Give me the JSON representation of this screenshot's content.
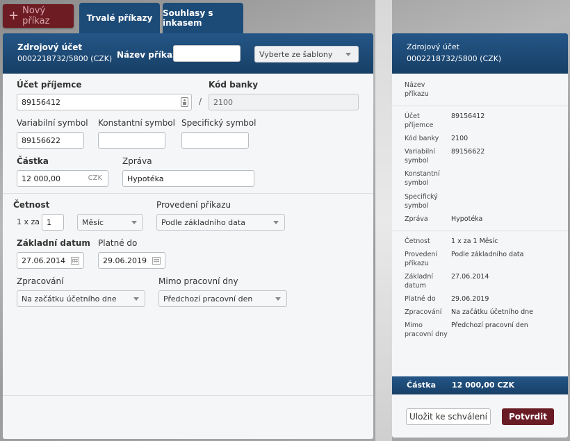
{
  "top": {
    "new_order": "Nový příkaz",
    "tabs": [
      "Trvalé příkazy",
      "Souhlasy s inkasem"
    ]
  },
  "form": {
    "source_label": "Zdrojový účet",
    "source_account": "0002218732/5800 (CZK)",
    "name_label": "Název příkazu",
    "name_value": "",
    "template_select": "Vyberte ze šablony",
    "recipient_label": "Účet příjemce",
    "recipient_value": "89156412",
    "bank_label": "Kód banky",
    "bank_value": "2100",
    "slash": "/",
    "vs_label": "Variabilní symbol",
    "vs_value": "89156622",
    "ks_label": "Konstantní symbol",
    "ks_value": "",
    "ss_label": "Specifický symbol",
    "ss_value": "",
    "amount_label": "Částka",
    "amount_value": "12 000,00",
    "currency": "CZK",
    "message_label": "Zpráva",
    "message_value": "Hypotéka",
    "frequency_label": "Četnost",
    "frequency_prefix": "1 x za",
    "frequency_count": "1",
    "frequency_unit": "Měsíc",
    "execution_label": "Provedení příkazu",
    "execution_value": "Podle základního data",
    "base_date_label": "Základní datum",
    "base_date_value": "27.06.2014",
    "valid_to_label": "Platné do",
    "valid_to_value": "29.06.2019",
    "processing_label": "Zpracování",
    "processing_value": "Na začátku účetního dne",
    "nonworking_label": "Mimo pracovní dny",
    "nonworking_value": "Předchozí pracovní den"
  },
  "summary": {
    "source_label": "Zdrojový účet",
    "source_account": "0002218732/5800 (CZK)",
    "name_label": "Název příkazu",
    "rows1": [
      {
        "label": "Účet příjemce",
        "value": "89156412"
      },
      {
        "label": "Kód banky",
        "value": "2100"
      },
      {
        "label": "Variabilní symbol",
        "value": "89156622"
      },
      {
        "label": "Konstantní symbol",
        "value": ""
      },
      {
        "label": "Specifický symbol",
        "value": ""
      },
      {
        "label": "Zpráva",
        "value": "Hypotéka"
      }
    ],
    "rows2": [
      {
        "label": "Četnost",
        "value": "1 x za 1 Měsíc"
      },
      {
        "label": "Provedení příkazu",
        "value": "Podle základního data"
      },
      {
        "label": "Základní datum",
        "value": "27.06.2014"
      },
      {
        "label": "Platné do",
        "value": "29.06.2019"
      },
      {
        "label": "Zpracování",
        "value": "Na začátku účetního dne"
      },
      {
        "label": "Mimo pracovní dny",
        "value": "Předchozí pracovní den"
      }
    ],
    "total_label": "Částka",
    "total_value": "12 000,00 CZK",
    "save_button": "Uložit ke schválení",
    "confirm_button": "Potvrdit"
  }
}
